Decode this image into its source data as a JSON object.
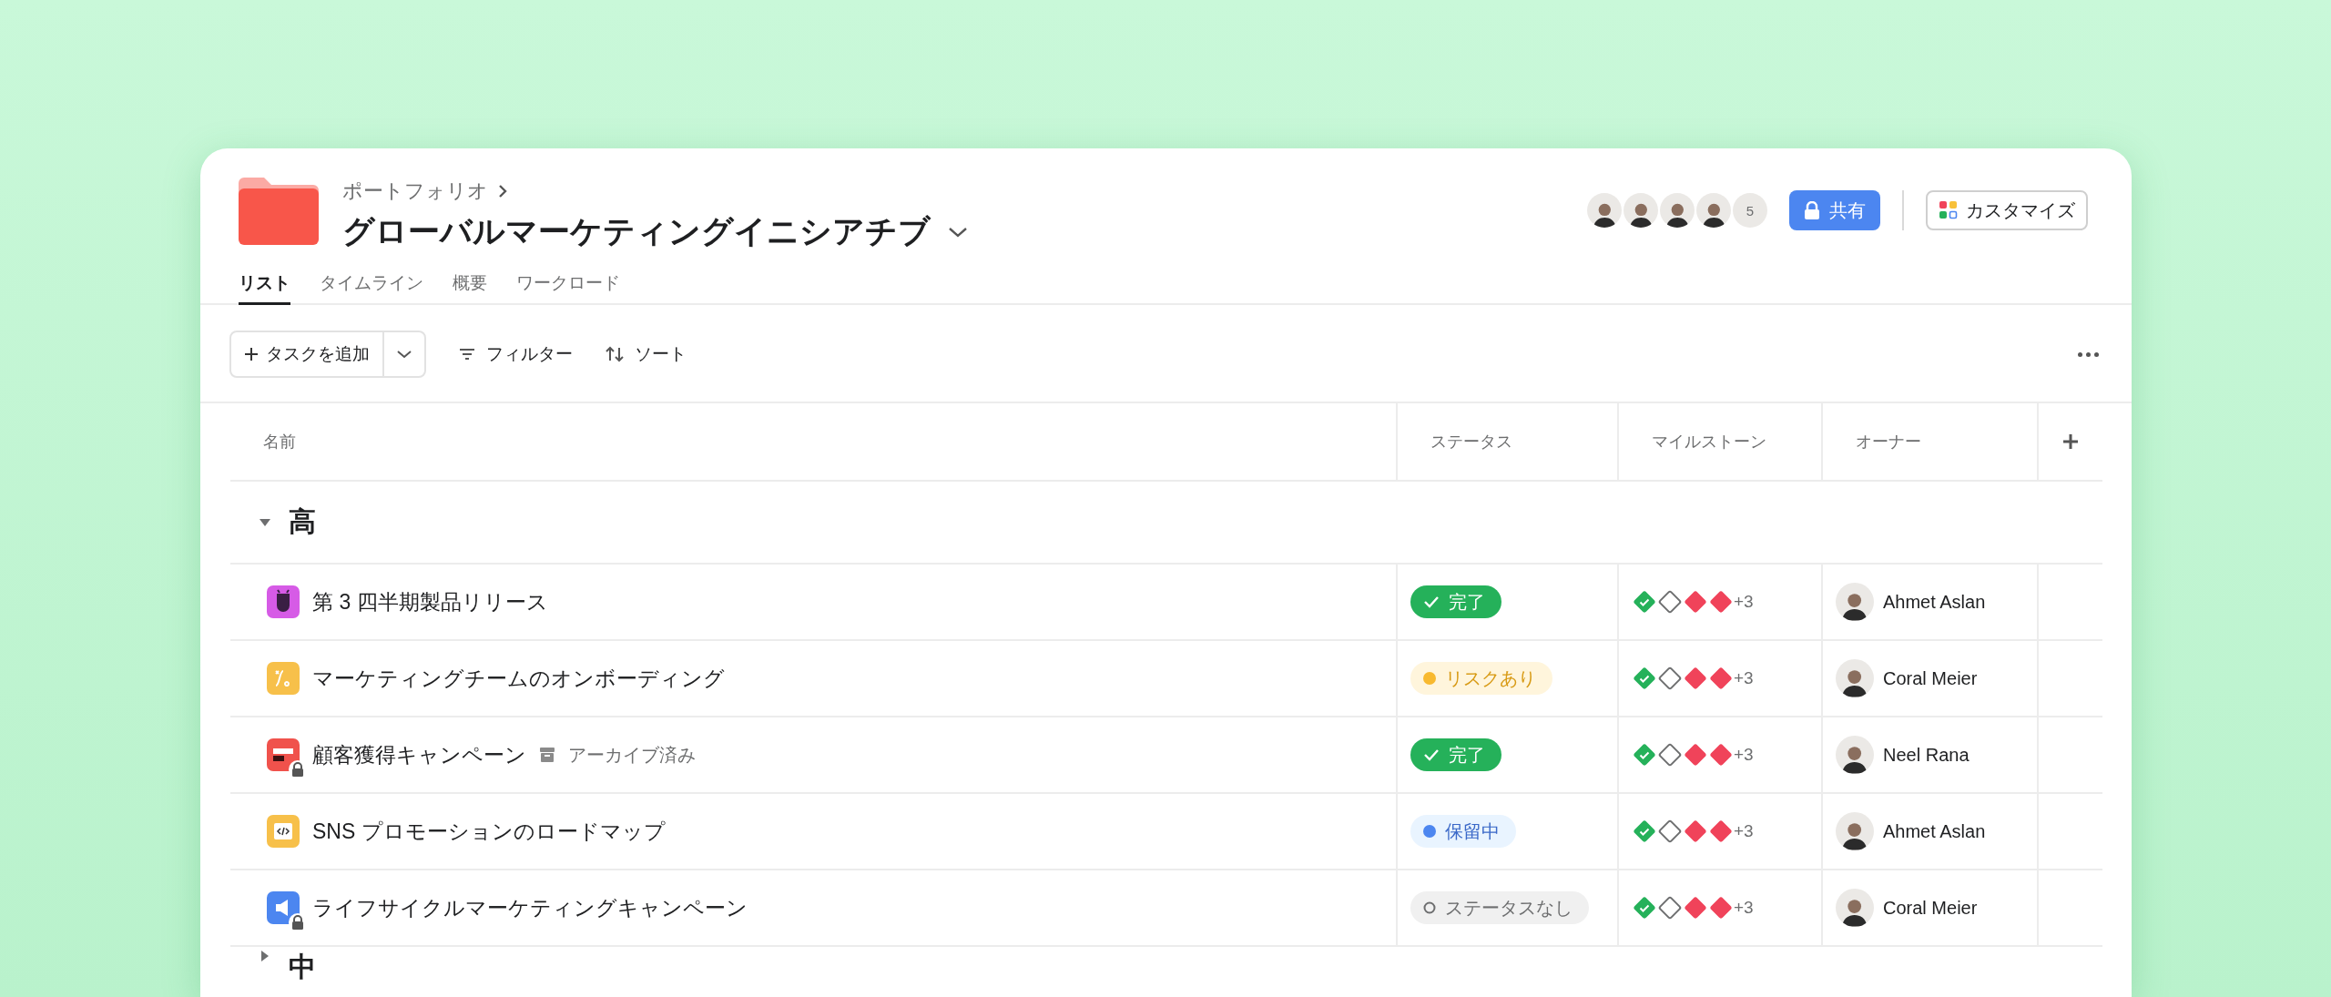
{
  "header": {
    "breadcrumb": "ポートフォリオ",
    "title": "グローバルマーケティングイニシアチブ",
    "members": [
      {
        "kind": "person"
      },
      {
        "kind": "person"
      },
      {
        "kind": "person"
      },
      {
        "kind": "person"
      }
    ],
    "member_count": "5",
    "share_button": "共有",
    "customize_button": "カスタマイズ"
  },
  "tabs": [
    {
      "label": "リスト",
      "selected": true
    },
    {
      "label": "タイムライン",
      "selected": false
    },
    {
      "label": "概要",
      "selected": false
    },
    {
      "label": "ワークロード",
      "selected": false
    }
  ],
  "toolbar": {
    "add_button": "タスクを追加",
    "filter": "フィルター",
    "sort": "ソート"
  },
  "table": {
    "columns": [
      "名前",
      "ステータス",
      "マイルストーン",
      "オーナー"
    ],
    "groups": [
      {
        "title": "高",
        "expanded": true,
        "rows": [
          {
            "name": "第 3 四半期製品リリース",
            "kind": "bug",
            "color": "#d65be6",
            "locked": false,
            "status": {
              "kind": "done",
              "label": "完了"
            },
            "milestones": [
              {
                "kind": "done"
              },
              {
                "kind": "open"
              },
              {
                "kind": "missed"
              },
              {
                "kind": "missed"
              }
            ],
            "milestones_more": "+3",
            "owner": "Ahmet Aslan"
          },
          {
            "name": "マーケティングチームのオンボーディング",
            "kind": "path",
            "color": "#f7c04a",
            "locked": false,
            "status": {
              "kind": "at_risk",
              "label": "リスクあり"
            },
            "milestones": [
              {
                "kind": "done"
              },
              {
                "kind": "open"
              },
              {
                "kind": "missed"
              },
              {
                "kind": "missed"
              }
            ],
            "milestones_more": "+3",
            "owner": "Coral Meier"
          },
          {
            "name": "顧客獲得キャンペーン",
            "kind": "board",
            "color": "#f0524c",
            "locked": true,
            "archived": "アーカイブ済み",
            "status": {
              "kind": "done",
              "label": "完了"
            },
            "milestones": [
              {
                "kind": "done"
              },
              {
                "kind": "open"
              },
              {
                "kind": "missed"
              },
              {
                "kind": "missed"
              }
            ],
            "milestones_more": "+3",
            "owner": "Neel Rana"
          },
          {
            "name": "SNS プロモーションのロードマップ",
            "kind": "code",
            "color": "#f7c04a",
            "locked": false,
            "status": {
              "kind": "on_hold",
              "label": "保留中"
            },
            "milestones": [
              {
                "kind": "done"
              },
              {
                "kind": "open"
              },
              {
                "kind": "missed"
              },
              {
                "kind": "missed"
              }
            ],
            "milestones_more": "+3",
            "owner": "Ahmet Aslan"
          },
          {
            "name": "ライフサイクルマーケティングキャンペーン",
            "kind": "megaphone",
            "color": "#4c86f0",
            "locked": true,
            "status": {
              "kind": "none",
              "label": "ステータスなし"
            },
            "milestones": [
              {
                "kind": "done"
              },
              {
                "kind": "open"
              },
              {
                "kind": "missed"
              },
              {
                "kind": "missed"
              }
            ],
            "milestones_more": "+3",
            "owner": "Coral Meier"
          }
        ]
      },
      {
        "title": "中",
        "expanded": false
      }
    ]
  }
}
